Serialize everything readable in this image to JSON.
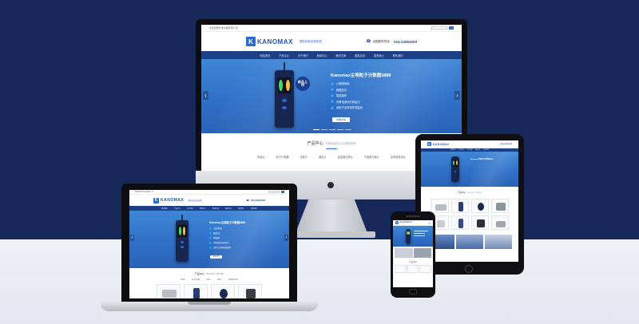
{
  "brand": {
    "logo_text": "KANOMAX",
    "logo_mark": "K",
    "tagline": "国际标准全球品质",
    "hotline_label": "全国服务热线：",
    "hotline_number": "024-23551000",
    "top_notice": "沈阳加野科学仪器有限公司",
    "primary_color": "#2b6bd6",
    "nav_color": "#1d3f86",
    "background_color": "#16275a"
  },
  "nav_items": [
    "网站首页",
    "产品中心",
    "关于我们",
    "新闻中心",
    "解决方案",
    "服务支持",
    "招贤纳士",
    "联系我们"
  ],
  "banner": {
    "title": "Kanomax尘埃粒子计数器3889",
    "badge": "新品上市",
    "features": [
      "六通道测量",
      "数据显示",
      "智能操作",
      "内置电池长时间运行",
      "适用于洁净室环境监测"
    ],
    "more_button": "查看详情",
    "left_arrow": "‹",
    "right_arrow": "›"
  },
  "product_center": {
    "title": "产品中心",
    "title_en": "PRODUCT CENTER",
    "categories": [
      "风速仪",
      "粒子计数器",
      "压差计",
      "微压计",
      "温湿度记录仪",
      "气溶胶光度计",
      "洁净室检测仪"
    ]
  },
  "tablet": {
    "title": "产品中心",
    "title_en": "PRODUCT CENTER"
  },
  "phone": {
    "title": "产品中心"
  }
}
